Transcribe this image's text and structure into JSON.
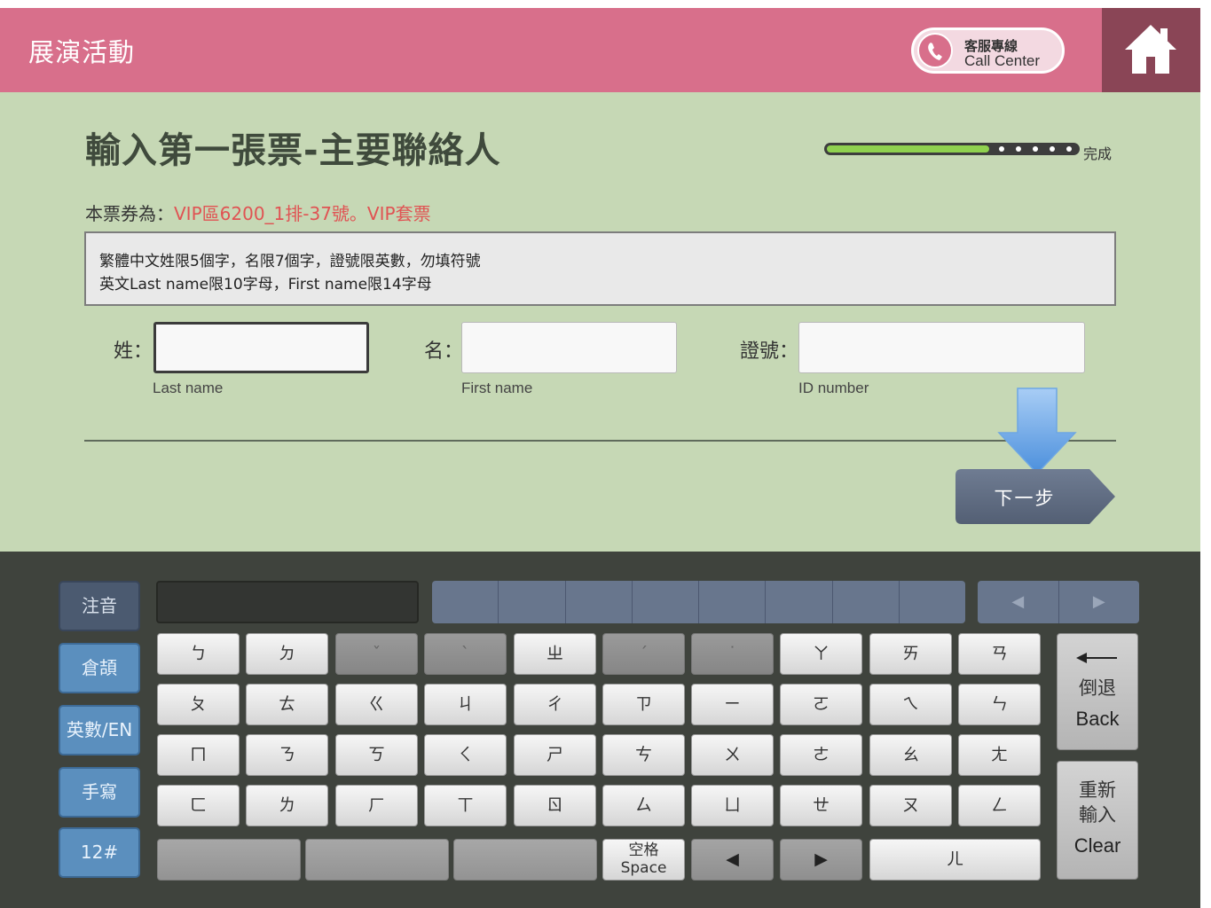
{
  "header": {
    "title": "展演活動",
    "call_center_zh": "客服專線",
    "call_center_en": "Call Center"
  },
  "main": {
    "page_title": "輸入第一張票-主要聯絡人",
    "progress": {
      "steps_total": 6,
      "steps_done": 1,
      "fraction": 0.65,
      "label": "完成"
    },
    "ticket_label": "本票券為：",
    "ticket_value": "VIP區6200_1排-37號。VIP套票",
    "notice": [
      "繁體中文姓限5個字，名限7個字，證號限英數，勿填符號",
      "英文Last name限10字母，First name限14字母"
    ],
    "fields": {
      "last_name": {
        "label": "姓：",
        "sub": "Last name",
        "value": ""
      },
      "first_name": {
        "label": "名：",
        "sub": "First name",
        "value": ""
      },
      "id_number": {
        "label": "證號：",
        "sub": "ID number",
        "value": ""
      }
    },
    "next_label": "下一步"
  },
  "keyboard": {
    "modes": [
      "注音",
      "倉頡",
      "英數/EN",
      "手寫",
      "12#"
    ],
    "active_mode": "注音",
    "candidate_prev": "◀",
    "candidate_next": "▶",
    "rows": [
      [
        "ㄅ",
        "ㄉ",
        "ˇ",
        "ˋ",
        "ㄓ",
        "ˊ",
        "˙",
        "ㄚ",
        "ㄞ",
        "ㄢ"
      ],
      [
        "ㄆ",
        "ㄊ",
        "ㄍ",
        "ㄐ",
        "ㄔ",
        "ㄗ",
        "ㄧ",
        "ㄛ",
        "ㄟ",
        "ㄣ"
      ],
      [
        "ㄇ",
        "ㄋ",
        "ㄎ",
        "ㄑ",
        "ㄕ",
        "ㄘ",
        "ㄨ",
        "ㄜ",
        "ㄠ",
        "ㄤ"
      ],
      [
        "ㄈ",
        "ㄌ",
        "ㄏ",
        "ㄒ",
        "ㄖ",
        "ㄙ",
        "ㄩ",
        "ㄝ",
        "ㄡ",
        "ㄥ"
      ]
    ],
    "tone_keys": [
      "ˇ",
      "ˋ",
      "ˊ",
      "˙"
    ],
    "space_zh": "空格",
    "space_en": "Space",
    "cursor_left": "◀",
    "cursor_right": "▶",
    "er_key": "ㄦ",
    "back_zh": "倒退",
    "back_en": "Back",
    "clear_zh": "重新輸入",
    "clear_en": "Clear"
  }
}
